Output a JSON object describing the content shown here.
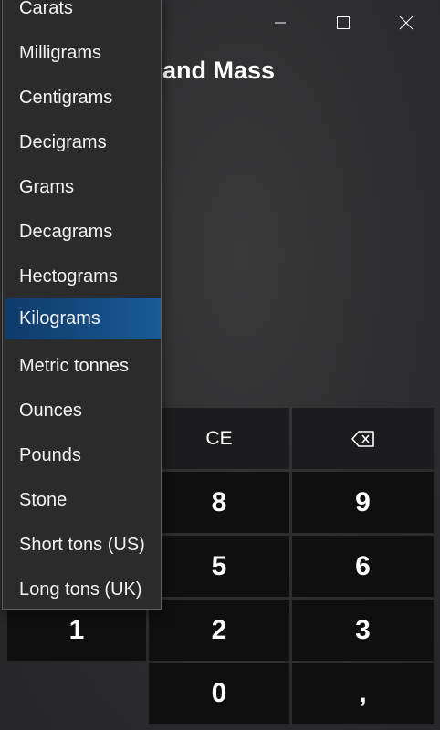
{
  "window": {
    "minimize_icon": "minimize-icon",
    "maximize_icon": "maximize-icon",
    "close_icon": "close-icon"
  },
  "header": {
    "title": "and Mass"
  },
  "unit_dropdown": {
    "selected": "Kilograms",
    "items": [
      "Carats",
      "Milligrams",
      "Centigrams",
      "Decigrams",
      "Grams",
      "Decagrams",
      "Hectograms",
      "Kilograms",
      "Metric tonnes",
      "Ounces",
      "Pounds",
      "Stone",
      "Short tons (US)",
      "Long tons (UK)"
    ]
  },
  "keypad": {
    "ce": "CE",
    "backspace_icon": "backspace-icon",
    "k8": "8",
    "k9": "9",
    "k5": "5",
    "k6": "6",
    "k1": "1",
    "k2": "2",
    "k3": "3",
    "k0": "0",
    "decimal": ","
  },
  "colors": {
    "background": "#2e2e30",
    "key": "#0f0f10",
    "key_function": "#1c1c1e",
    "dropdown": "#2b2b2b",
    "selected": "#1a5a96"
  }
}
